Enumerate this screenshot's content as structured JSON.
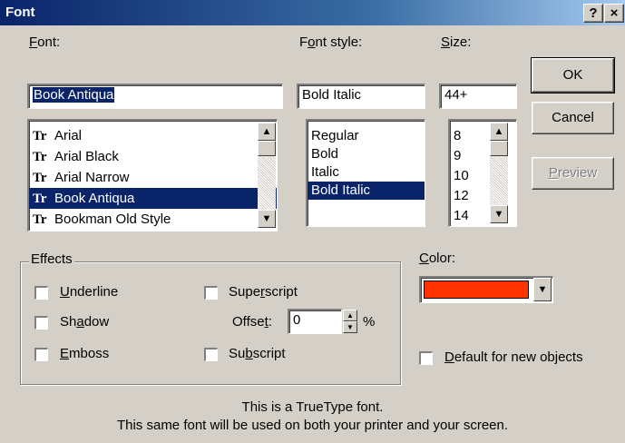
{
  "window": {
    "title": "Font",
    "help_label": "?",
    "close_label": "×"
  },
  "font": {
    "label_pre": "",
    "label_ul": "F",
    "label_post": "ont:",
    "value": "Book Antiqua",
    "items": [
      "Arial",
      "Arial Black",
      "Arial Narrow",
      "Book Antiqua",
      "Bookman Old Style"
    ],
    "selected_index": 3,
    "tt_glyph": "Tr"
  },
  "style": {
    "label_pre": "F",
    "label_ul": "o",
    "label_post": "nt style:",
    "value": "Bold Italic",
    "items": [
      "Regular",
      "Bold",
      "Italic",
      "Bold Italic"
    ],
    "selected_index": 3
  },
  "size": {
    "label_pre": "",
    "label_ul": "S",
    "label_post": "ize:",
    "value": "44+",
    "items": [
      "8",
      "9",
      "10",
      "12",
      "14"
    ]
  },
  "buttons": {
    "ok": "OK",
    "cancel": "Cancel",
    "preview_ul": "P",
    "preview_post": "review"
  },
  "effects": {
    "title": "Effects",
    "underline": {
      "ul": "U",
      "post": "nderline",
      "checked": false
    },
    "shadow": {
      "pre": "Sh",
      "ul": "a",
      "post": "dow",
      "checked": false
    },
    "emboss": {
      "ul": "E",
      "post": "mboss",
      "checked": false
    },
    "superscript": {
      "pre": "Supe",
      "ul": "r",
      "post": "script",
      "checked": false
    },
    "offset": {
      "pre": "Offse",
      "ul": "t",
      "post": ":",
      "value": "0",
      "unit": "%"
    },
    "subscript": {
      "pre": "Su",
      "ul": "b",
      "post": "script",
      "checked": false
    }
  },
  "color": {
    "label_ul": "C",
    "label_post": "olor:",
    "value_hex": "#ff3300",
    "default_label_ul": "D",
    "default_label_post": "efault for new objects"
  },
  "info": {
    "line1": "This is a TrueType font.",
    "line2": "This same font will be used on both your printer and your screen."
  }
}
